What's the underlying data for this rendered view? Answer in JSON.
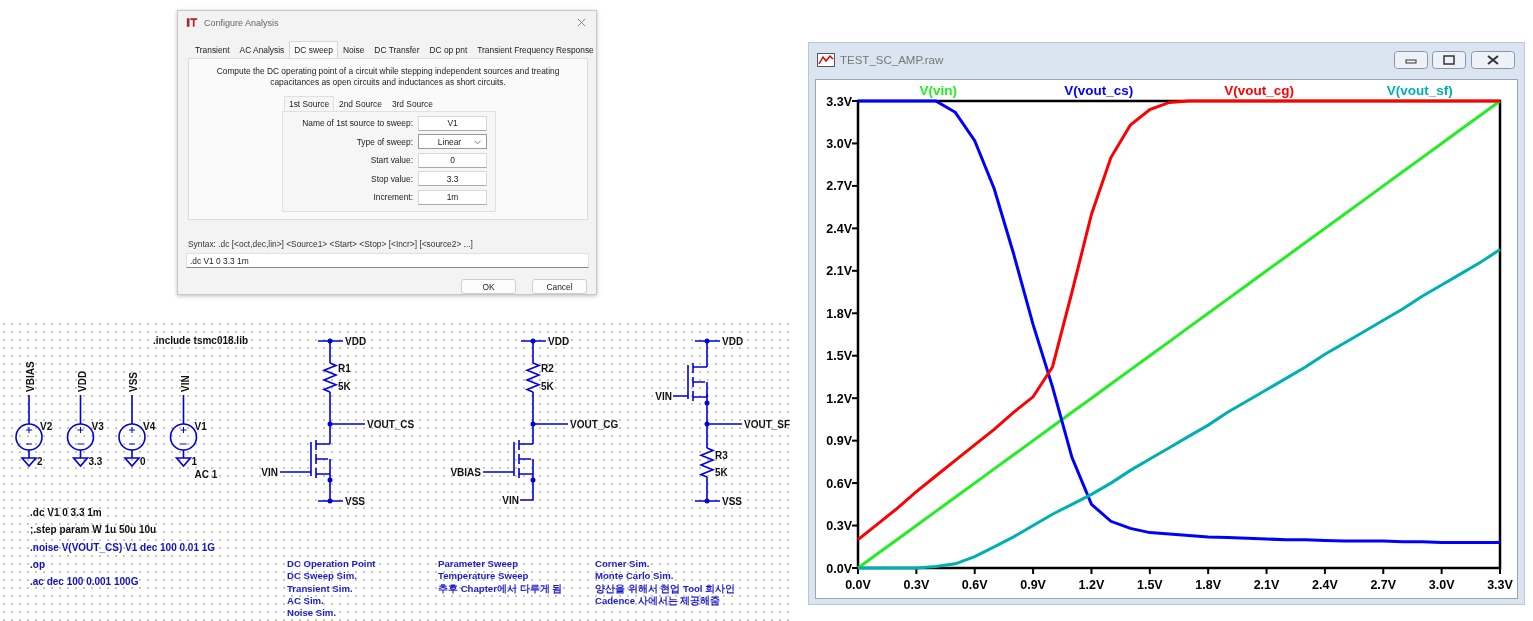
{
  "dialog": {
    "title": "Configure Analysis",
    "tabs": [
      {
        "label": "Transient",
        "selected": false
      },
      {
        "label": "AC Analysis",
        "selected": false
      },
      {
        "label": "DC sweep",
        "selected": true
      },
      {
        "label": "Noise",
        "selected": false
      },
      {
        "label": "DC Transfer",
        "selected": false
      },
      {
        "label": "DC op pnt",
        "selected": false
      },
      {
        "label": "Transient Frequency Response",
        "selected": false
      }
    ],
    "description": "Compute the DC operating point of a circuit while stepping independent sources and treating capacitances as open circuits and inductances as short circuits.",
    "source_tabs": [
      {
        "label": "1st Source",
        "selected": true
      },
      {
        "label": "2nd Source",
        "selected": false
      },
      {
        "label": "3rd Source",
        "selected": false
      }
    ],
    "fields": [
      {
        "label": "Name of 1st source to sweep:",
        "value": "V1",
        "kind": "text"
      },
      {
        "label": "Type of sweep:",
        "value": "Linear",
        "kind": "dropdown"
      },
      {
        "label": "Start value:",
        "value": "0",
        "kind": "text"
      },
      {
        "label": "Stop value:",
        "value": "3.3",
        "kind": "text"
      },
      {
        "label": "Increment:",
        "value": "1m",
        "kind": "text"
      }
    ],
    "syntax": "Syntax:  .dc [<oct,dec,lin>] <Source1> <Start> <Stop> [<Incr>] [<source2> ...]",
    "command": ".dc V1 0 3.3 1m",
    "buttons": [
      {
        "label": "OK"
      },
      {
        "label": "Cancel"
      }
    ]
  },
  "schematic": {
    "include": ".include tsmc018.lib",
    "sources": [
      {
        "name": "V2",
        "net": "VBIAS",
        "value": "2"
      },
      {
        "name": "V3",
        "net": "VDD",
        "value": "3.3"
      },
      {
        "name": "V4",
        "net": "VSS",
        "value": "0"
      },
      {
        "name": "V1",
        "net": "VIN",
        "value": "1",
        "extra": "AC 1"
      }
    ],
    "circuits": [
      {
        "kind": "cs",
        "top": "VDD",
        "resistor": "R1",
        "resistor_value": "5K",
        "output": "VOUT_CS",
        "gate": "VIN",
        "bottom": "VSS"
      },
      {
        "kind": "cg",
        "top": "VDD",
        "resistor": "R2",
        "resistor_value": "5K",
        "output": "VOUT_CG",
        "gate": "VBIAS",
        "bottom": "VIN"
      },
      {
        "kind": "sf",
        "top": "VDD",
        "resistor": "R3",
        "resistor_value": "5K",
        "output": "VOUT_SF",
        "gate": "VIN",
        "bottom": "VSS"
      }
    ],
    "directives": [
      {
        "text": ".dc V1 0 3.3 1m",
        "active": true
      },
      {
        "text": ";.step param W 1u 50u 10u",
        "active": true
      },
      {
        "text": ".noise V(VOUT_CS) V1 dec 100 0.01 1G",
        "active": false
      },
      {
        "text": ".op",
        "active": false
      },
      {
        "text": ".ac dec 100 0.001 100G",
        "active": false
      }
    ],
    "notes": [
      {
        "lines": [
          "DC Operation Point",
          "DC Sweep Sim.",
          "Transient Sim.",
          "AC Sim.",
          "Noise Sim."
        ]
      },
      {
        "lines": [
          "Parameter Sweep",
          "Temperature Sweep",
          "추후 **Chapter**에서 다루게 됨"
        ]
      },
      {
        "lines": [
          "Corner Sim.",
          "Monte Carlo Sim.",
          "양산을 위해서 현업 **Tool** 회사인",
          "**Cadence** 사에서는 제공해줌"
        ]
      }
    ]
  },
  "plot": {
    "title": "TEST_SC_AMP.raw",
    "chart_data": {
      "type": "line",
      "x": [
        0,
        0.1,
        0.2,
        0.3,
        0.4,
        0.5,
        0.6,
        0.7,
        0.8,
        0.9,
        1.0,
        1.1,
        1.2,
        1.3,
        1.4,
        1.5,
        1.6,
        1.7,
        1.8,
        1.9,
        2.0,
        2.1,
        2.2,
        2.3,
        2.4,
        2.5,
        2.6,
        2.7,
        2.8,
        2.9,
        3.0,
        3.1,
        3.2,
        3.3
      ],
      "series": [
        {
          "name": "V(vin)",
          "color": "#22ee22",
          "values": [
            0,
            0.1,
            0.2,
            0.3,
            0.4,
            0.5,
            0.6,
            0.7,
            0.8,
            0.9,
            1.0,
            1.1,
            1.2,
            1.3,
            1.4,
            1.5,
            1.6,
            1.7,
            1.8,
            1.9,
            2.0,
            2.1,
            2.2,
            2.3,
            2.4,
            2.5,
            2.6,
            2.7,
            2.8,
            2.9,
            3.0,
            3.1,
            3.2,
            3.3
          ]
        },
        {
          "name": "V(vout_cs)",
          "color": "#0000ff",
          "values": [
            3.3,
            3.3,
            3.3,
            3.3,
            3.3,
            3.22,
            3.02,
            2.68,
            2.22,
            1.72,
            1.28,
            0.78,
            0.45,
            0.33,
            0.28,
            0.25,
            0.24,
            0.23,
            0.22,
            0.215,
            0.21,
            0.205,
            0.2,
            0.2,
            0.195,
            0.19,
            0.19,
            0.19,
            0.185,
            0.185,
            0.18,
            0.18,
            0.18,
            0.18
          ]
        },
        {
          "name": "V(vout_cg)",
          "color": "#ff0000",
          "values": [
            0.2,
            0.31,
            0.42,
            0.54,
            0.65,
            0.76,
            0.87,
            0.98,
            1.1,
            1.21,
            1.42,
            1.95,
            2.5,
            2.9,
            3.13,
            3.24,
            3.29,
            3.3,
            3.3,
            3.3,
            3.3,
            3.3,
            3.3,
            3.3,
            3.3,
            3.3,
            3.3,
            3.3,
            3.3,
            3.3,
            3.3,
            3.3,
            3.3,
            3.3
          ]
        },
        {
          "name": "V(vout_sf)",
          "color": "#00b0b0",
          "values": [
            0,
            0,
            0,
            0,
            0.01,
            0.03,
            0.08,
            0.15,
            0.22,
            0.3,
            0.38,
            0.45,
            0.52,
            0.6,
            0.69,
            0.77,
            0.85,
            0.93,
            1.01,
            1.1,
            1.18,
            1.26,
            1.34,
            1.42,
            1.51,
            1.59,
            1.67,
            1.75,
            1.83,
            1.92,
            2.0,
            2.08,
            2.16,
            2.25
          ]
        }
      ],
      "xlim": [
        0,
        3.3
      ],
      "ylim": [
        0,
        3.3
      ],
      "xticks": [
        {
          "value": 0,
          "label": "0.0V"
        },
        {
          "value": 0.3,
          "label": "0.3V"
        },
        {
          "value": 0.6,
          "label": "0.6V"
        },
        {
          "value": 0.9,
          "label": "0.9V"
        },
        {
          "value": 1.2,
          "label": "1.2V"
        },
        {
          "value": 1.5,
          "label": "1.5V"
        },
        {
          "value": 1.8,
          "label": "1.8V"
        },
        {
          "value": 2.1,
          "label": "2.1V"
        },
        {
          "value": 2.4,
          "label": "2.4V"
        },
        {
          "value": 2.7,
          "label": "2.7V"
        },
        {
          "value": 3.0,
          "label": "3.0V"
        },
        {
          "value": 3.3,
          "label": "3.3V"
        }
      ],
      "yticks": [
        {
          "value": 0,
          "label": "0.0V"
        },
        {
          "value": 0.3,
          "label": "0.3V"
        },
        {
          "value": 0.6,
          "label": "0.6V"
        },
        {
          "value": 0.9,
          "label": "0.9V"
        },
        {
          "value": 1.2,
          "label": "1.2V"
        },
        {
          "value": 1.5,
          "label": "1.5V"
        },
        {
          "value": 1.8,
          "label": "1.8V"
        },
        {
          "value": 2.1,
          "label": "2.1V"
        },
        {
          "value": 2.4,
          "label": "2.4V"
        },
        {
          "value": 2.7,
          "label": "2.7V"
        },
        {
          "value": 3.0,
          "label": "3.0V"
        },
        {
          "value": 3.3,
          "label": "3.3V"
        }
      ]
    }
  }
}
